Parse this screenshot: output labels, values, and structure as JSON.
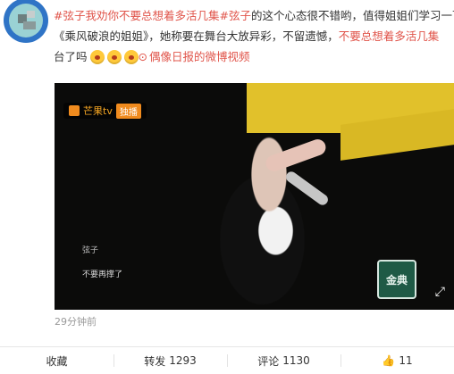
{
  "post": {
    "line1": {
      "tag1": "#弦子",
      "tag1_space": " ",
      "red1": "我劝你不要总想着多活几集",
      "tag2": "#弦子",
      "text1": "的这个心态很不错哟，值得姐姐们学习一下"
    },
    "line2": {
      "text": "《乘风破浪的姐姐》，她称要在舞台大放异彩，不留遗憾，",
      "red": "不要总想着多活几集"
    },
    "line3": {
      "text": "台了吗",
      "link_label": "偶像日报的微博视频"
    },
    "emojis": [
      "emoji-face",
      "emoji-face",
      "emoji-face"
    ]
  },
  "video": {
    "brand": "芒果tv",
    "live_tag": "独播",
    "subtitle_name": "弦子",
    "subtitle_line": "不要再撑了",
    "badge_text": "金典"
  },
  "meta": {
    "time": "29分钟前"
  },
  "actions": {
    "fav": "收藏",
    "repost_label": "转发",
    "repost_count": "1293",
    "comment_label": "评论",
    "comment_count": "1130",
    "like_count": "11"
  }
}
